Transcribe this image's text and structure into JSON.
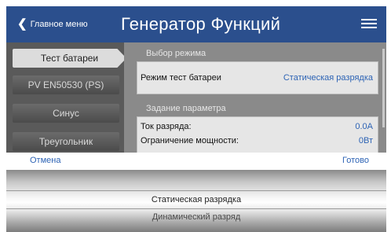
{
  "header": {
    "back_label": "Главное меню",
    "title": "Генератор Функций"
  },
  "sidebar": {
    "items": [
      {
        "label": "Тест батареи",
        "active": true
      },
      {
        "label": "PV EN50530 (PS)"
      },
      {
        "label": "Синус"
      },
      {
        "label": "Треугольник"
      }
    ]
  },
  "main": {
    "mode_group_title": "Выбор режима",
    "mode_row": {
      "label": "Режим тест батареи",
      "value": "Статическая разрядка"
    },
    "param_group_title": "Задание параметра",
    "params": [
      {
        "label": "Ток разряда:",
        "value": "0.0A"
      },
      {
        "label": "Ограничение мощности:",
        "value": "0Вт"
      }
    ]
  },
  "picker": {
    "cancel_label": "Отмена",
    "done_label": "Готово",
    "options": [
      "Статическая разрядка",
      "Динамический разряд"
    ]
  },
  "colors": {
    "header_blue": "#2b4f8d",
    "link_blue": "#2e64b5"
  }
}
